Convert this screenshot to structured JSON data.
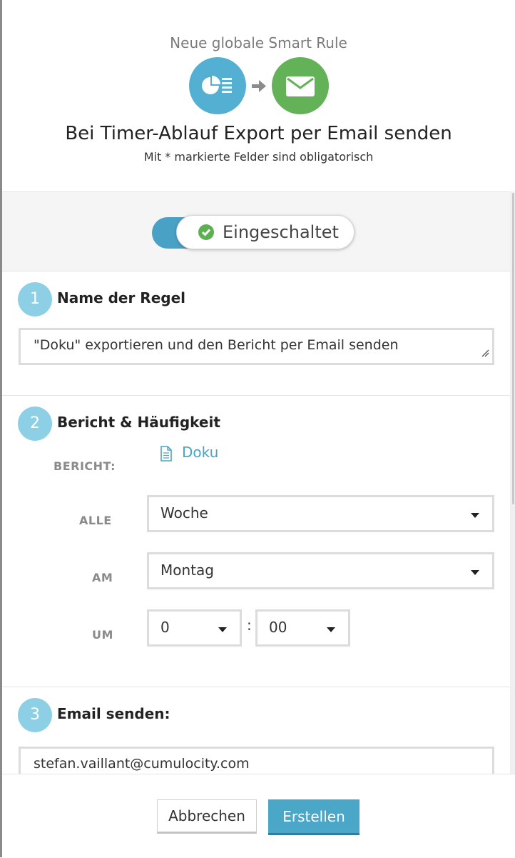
{
  "header": {
    "subtitle": "Neue globale Smart Rule",
    "title": "Bei Timer-Ablauf Export per Email senden",
    "required_note": "Mit * markierte Felder sind obligatorisch",
    "icons": [
      "report-icon",
      "arrow-right-icon",
      "envelope-icon"
    ]
  },
  "toggle": {
    "label": "Eingeschaltet",
    "state": "on"
  },
  "section1": {
    "number": "1",
    "title": "Name der Regel",
    "value": "\"Doku\" exportieren und den Bericht per Email senden"
  },
  "section2": {
    "number": "2",
    "title": "Bericht & Häufigkeit",
    "report_label": "BERICHT:",
    "report_value": "Doku",
    "every_label": "ALLE",
    "every_value": "Woche",
    "on_label": "AM",
    "on_value": "Montag",
    "at_label": "UM",
    "hour_value": "0",
    "colon": ":",
    "minute_value": "00"
  },
  "section3": {
    "number": "3",
    "title": "Email senden:",
    "email_value": "stefan.vaillant@cumulocity.com"
  },
  "footer": {
    "cancel_label": "Abbrechen",
    "create_label": "Erstellen"
  },
  "colors": {
    "accent": "#4ba7c8",
    "success": "#5db052",
    "step": "#8dd0e6"
  }
}
